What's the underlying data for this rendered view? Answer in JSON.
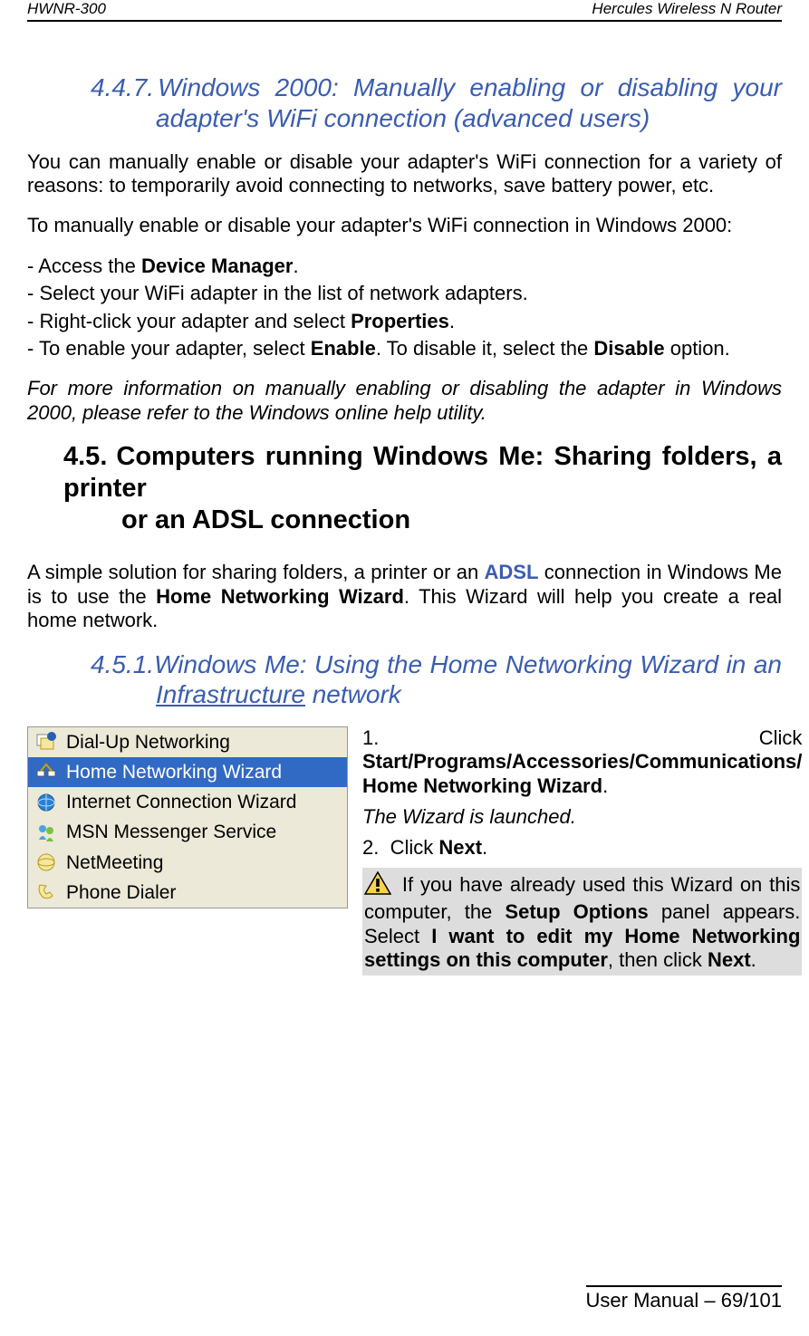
{
  "header": {
    "left": "HWNR-300",
    "right": "Hercules Wireless N Router"
  },
  "sec447": {
    "num": "4.4.7.",
    "title1": "Windows 2000: Manually enabling or disabling your",
    "title2": "adapter's WiFi connection (advanced users)"
  },
  "p1": "You can manually enable or disable your adapter's WiFi connection for a variety of reasons: to temporarily avoid connecting to networks, save battery power, etc.",
  "p2": "To manually enable or disable your adapter's WiFi connection in Windows 2000:",
  "li1a": "- Access the ",
  "li1b": "Device Manager",
  "li1c": ".",
  "li2": "- Select your WiFi adapter in the list of network adapters.",
  "li3a": "- Right-click your adapter and select ",
  "li3b": "Properties",
  "li3c": ".",
  "li4a": "- To enable your adapter, select ",
  "li4b": "Enable",
  "li4c": ".  To disable it, select the ",
  "li4d": "Disable",
  "li4e": " option.",
  "p3": "For more information on manually enabling or disabling the adapter in Windows 2000, please refer to the Windows online help utility.",
  "sec45": {
    "num": "4.5.",
    "title1": "Computers running Windows Me: Sharing folders, a printer",
    "title2": "or an ADSL connection"
  },
  "p4a": "A simple solution for sharing folders, a printer or an ",
  "p4adsl": "ADSL",
  "p4b": " connection in Windows Me is to use the ",
  "p4c": "Home Networking Wizard",
  "p4d": ".  This Wizard will help you create a real home network.",
  "sec451": {
    "num": "4.5.1.",
    "title1": "Windows Me: Using the Home Networking Wizard in an",
    "infra": "Infrastructure",
    "title2": " network"
  },
  "menu": {
    "items": [
      {
        "label": "Dial-Up Networking",
        "selected": false
      },
      {
        "label": "Home Networking Wizard",
        "selected": true
      },
      {
        "label": "Internet Connection Wizard",
        "selected": false
      },
      {
        "label": "MSN Messenger Service",
        "selected": false
      },
      {
        "label": "NetMeeting",
        "selected": false
      },
      {
        "label": "Phone Dialer",
        "selected": false
      }
    ]
  },
  "step1a": "Click ",
  "step1b": "Start/Programs/Accessories/Communications/ Home Networking Wizard",
  "step1c": ".",
  "launched": "The Wizard is launched.",
  "step2a": "Click ",
  "step2b": "Next",
  "step2c": ".",
  "warn_a": " If you have already used this Wizard on this computer, the ",
  "warn_b": "Setup Options",
  "warn_c": " panel appears. Select ",
  "warn_d": "I want to edit my Home Networking settings on this computer",
  "warn_e": ", then click ",
  "warn_f": "Next",
  "warn_g": ".",
  "footer": "User Manual – 69/101"
}
